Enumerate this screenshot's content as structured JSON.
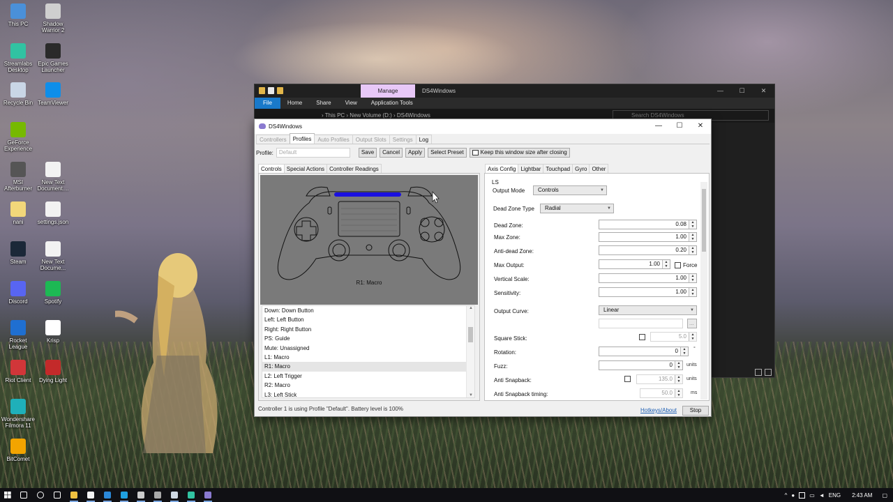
{
  "desktop": {
    "icons": [
      {
        "label": "This PC",
        "icon": "this-pc-icon",
        "color": "#4a90d9"
      },
      {
        "label": "Shadow Warrior 2",
        "icon": "shadow-warrior-icon",
        "color": "#cfcfcf"
      },
      {
        "label": "Streamlabs Desktop",
        "icon": "streamlabs-icon",
        "color": "#31c3a2"
      },
      {
        "label": "Epic Games Launcher",
        "icon": "epic-games-icon",
        "color": "#2a2a2a"
      },
      {
        "label": "Recycle Bin",
        "icon": "recycle-bin-icon",
        "color": "#c9d6e6"
      },
      {
        "label": "TeamViewer",
        "icon": "teamviewer-icon",
        "color": "#0e8ee9"
      },
      {
        "label": "GeForce Experience",
        "icon": "geforce-icon",
        "color": "#76b900"
      },
      {
        "label": "MSI Afterburner",
        "icon": "msi-afterburner-icon",
        "color": "#555555"
      },
      {
        "label": "New Text Document....",
        "icon": "text-document-icon",
        "color": "#f2f2f2"
      },
      {
        "label": "nani",
        "icon": "folder-icon",
        "color": "#f2d77a"
      },
      {
        "label": "settings.json",
        "icon": "json-file-icon",
        "color": "#f2f2f2"
      },
      {
        "label": "Steam",
        "icon": "steam-icon",
        "color": "#1b2838"
      },
      {
        "label": "New Text Docume...",
        "icon": "text-document-icon",
        "color": "#f2f2f2"
      },
      {
        "label": "Discord",
        "icon": "discord-icon",
        "color": "#5865f2"
      },
      {
        "label": "Spotify",
        "icon": "spotify-icon",
        "color": "#1db954"
      },
      {
        "label": "Rocket League",
        "icon": "rocket-league-icon",
        "color": "#1f6fd1"
      },
      {
        "label": "Krisp",
        "icon": "krisp-icon",
        "color": "#ffffff"
      },
      {
        "label": "Riot Client",
        "icon": "riot-client-icon",
        "color": "#d13639"
      },
      {
        "label": "Dying Light",
        "icon": "dying-light-icon",
        "color": "#c32a2a"
      },
      {
        "label": "Wondershare Filmora 11",
        "icon": "filmora-icon",
        "color": "#1fb0b9"
      },
      {
        "label": "BitComet",
        "icon": "bitcomet-icon",
        "color": "#f2a400"
      }
    ]
  },
  "explorer": {
    "manage_tab": "Manage",
    "title": "DS4Windows",
    "ribbon": [
      "File",
      "Home",
      "Share",
      "View",
      "Application Tools"
    ],
    "path": "› This PC  ›  New Volume (D:)  ›  DS4Windows",
    "search_placeholder": "Search DS4Windows",
    "controls": {
      "minimize": "—",
      "maximize": "☐",
      "close": "✕"
    }
  },
  "ds4": {
    "title": "DS4Windows",
    "controls": {
      "minimize": "—",
      "maximize": "☐",
      "close": "✕"
    },
    "tabs": [
      "Controllers",
      "Profiles",
      "Auto Profiles",
      "Output Slots",
      "Settings",
      "Log"
    ],
    "profile_label": "Profile:",
    "profile_placeholder": "Default",
    "buttons": {
      "save": "Save",
      "cancel": "Cancel",
      "apply": "Apply",
      "select_preset": "Select Preset",
      "keep_size": "Keep this window size after closing"
    },
    "left_tabs": [
      "Controls",
      "Special Actions",
      "Controller Readings"
    ],
    "pad_label": "R1: Macro",
    "lightbar_color": "#1a10e0",
    "mappings": [
      "Down: Down Button",
      "Left: Left Button",
      "Right: Right Button",
      "PS: Guide",
      "Mute: Unassigned",
      "L1: Macro",
      "R1: Macro",
      "L2: Left Trigger",
      "R2: Macro",
      "L3: Left Stick"
    ],
    "selected_mapping": "R1: Macro",
    "right_tabs": [
      "Axis Config",
      "Lightbar",
      "Touchpad",
      "Gyro",
      "Other"
    ],
    "axis": {
      "section": "LS",
      "output_mode_label": "Output Mode",
      "output_mode": "Controls",
      "dead_zone_type_label": "Dead Zone Type",
      "dead_zone_type": "Radial",
      "dead_zone_label": "Dead Zone:",
      "dead_zone": "0.08",
      "max_zone_label": "Max Zone:",
      "max_zone": "1.00",
      "anti_dead_zone_label": "Anti-dead Zone:",
      "anti_dead_zone": "0.20",
      "max_output_label": "Max Output:",
      "max_output": "1.00",
      "force_label": "Force",
      "vertical_scale_label": "Vertical Scale:",
      "vertical_scale": "1.00",
      "sensitivity_label": "Sensitivity:",
      "sensitivity": "1.00",
      "output_curve_label": "Output Curve:",
      "output_curve": "Linear",
      "custom_curve_button": "...",
      "square_stick_label": "Square Stick:",
      "square_stick_value": "5.0",
      "rotation_label": "Rotation:",
      "rotation": "0",
      "rotation_unit": "°",
      "fuzz_label": "Fuzz:",
      "fuzz": "0",
      "fuzz_unit": "units",
      "anti_snapback_label": "Anti Snapback:",
      "anti_snapback": "135.0",
      "anti_snapback_unit": "units",
      "anti_snapback_timing_label": "Anti Snapback timing:",
      "anti_snapback_timing": "50.0",
      "anti_snapback_timing_unit": "ms"
    },
    "status": "Controller 1 is using Profile \"Default\". Battery level is 100%",
    "hotkeys_link": "Hotkeys/About",
    "stop_button": "Stop"
  },
  "taskbar": {
    "apps": [
      {
        "icon": "search-icon",
        "color": "#ffffff"
      },
      {
        "icon": "cortana-icon",
        "color": "#ffffff"
      },
      {
        "icon": "task-view-icon",
        "color": "#ffffff"
      },
      {
        "icon": "file-explorer-icon",
        "color": "#f0c040"
      },
      {
        "icon": "notepad-icon",
        "color": "#f2f2f2"
      },
      {
        "icon": "mail-icon",
        "color": "#2b88d8"
      },
      {
        "icon": "edge-icon",
        "color": "#1fa0e0"
      },
      {
        "icon": "terminal-icon",
        "color": "#cccccc"
      },
      {
        "icon": "streamlabs-icon",
        "color": "#aaaaaa"
      },
      {
        "icon": "steam-icon",
        "color": "#cfd8e3"
      },
      {
        "icon": "streamlabs-desktop-icon",
        "color": "#31c3a2"
      },
      {
        "icon": "ds4windows-icon",
        "color": "#8a7ad0"
      }
    ],
    "language": "ENG",
    "time": "2:43 AM"
  }
}
